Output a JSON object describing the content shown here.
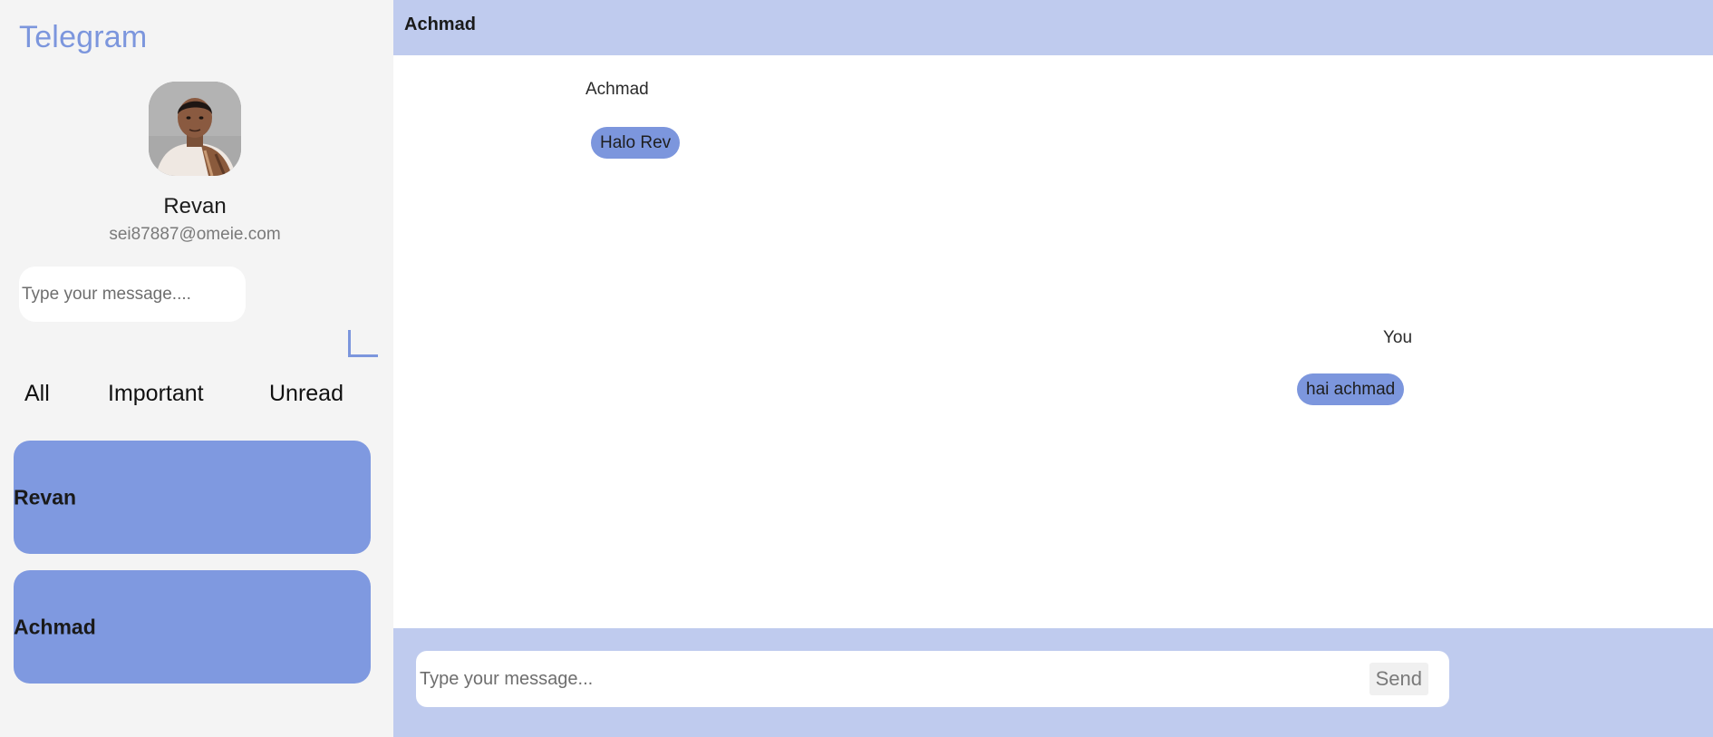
{
  "app": {
    "brand": "Telegram"
  },
  "profile": {
    "name": "Revan",
    "email": "sei87887@omeie.com"
  },
  "sidebar": {
    "search_placeholder": "Type your message....",
    "filters": [
      "All",
      "Important",
      "Unread"
    ],
    "chats": [
      {
        "name": "Revan"
      },
      {
        "name": "Achmad"
      }
    ]
  },
  "conversation": {
    "title": "Achmad",
    "messages": [
      {
        "sender": "Achmad",
        "text": "Halo Rev"
      },
      {
        "sender": "You",
        "text": "hai achmad"
      }
    ]
  },
  "composer": {
    "placeholder": "Type your message...",
    "send_label": "Send"
  },
  "colors": {
    "accent": "#7c96dd",
    "card": "#7f99e0",
    "bar": "#bfcbee",
    "sidebar_bg": "#f4f4f4"
  }
}
